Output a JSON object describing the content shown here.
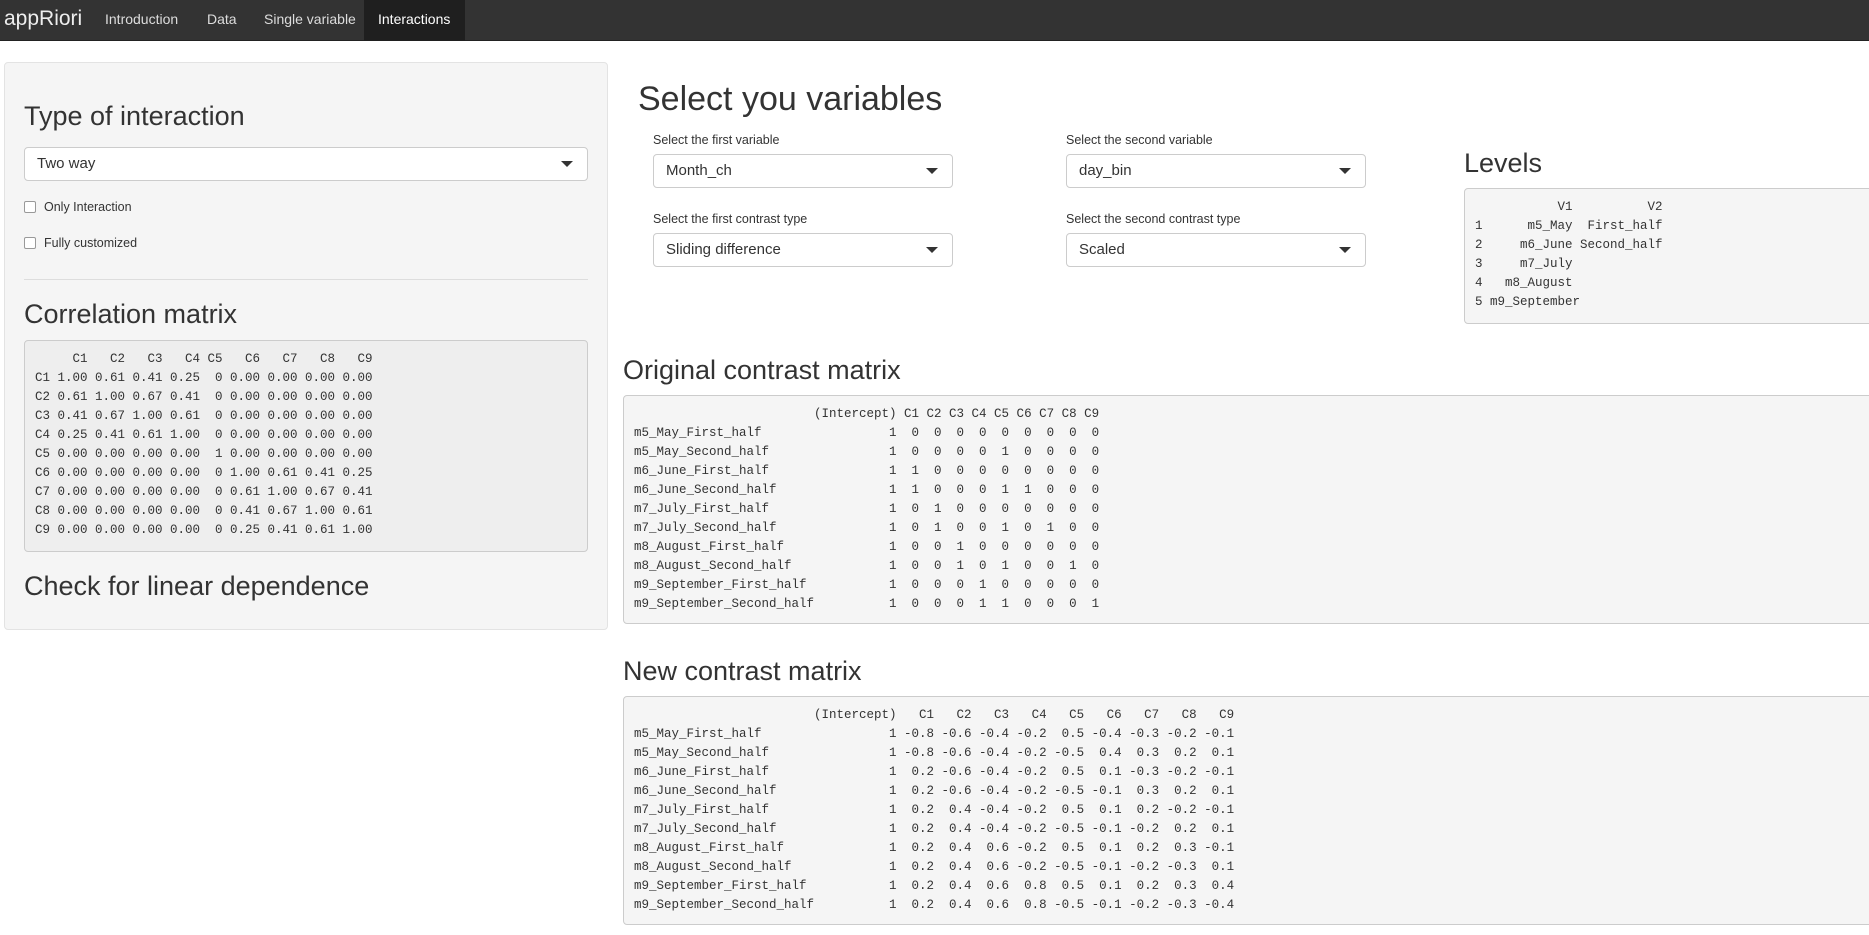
{
  "navbar": {
    "brand": "appRiori",
    "tabs": [
      "Introduction",
      "Data",
      "Single variable",
      "Interactions"
    ],
    "active_tab": "Interactions"
  },
  "sidebar": {
    "type_heading": "Type of interaction",
    "type_select_value": "Two way",
    "only_interaction_label": "Only Interaction",
    "fully_customized_label": "Fully customized",
    "correlation_heading": "Correlation matrix",
    "correlation_matrix": "     C1   C2   C3   C4 C5   C6   C7   C8   C9\nC1 1.00 0.61 0.41 0.25  0 0.00 0.00 0.00 0.00\nC2 0.61 1.00 0.67 0.41  0 0.00 0.00 0.00 0.00\nC3 0.41 0.67 1.00 0.61  0 0.00 0.00 0.00 0.00\nC4 0.25 0.41 0.61 1.00  0 0.00 0.00 0.00 0.00\nC5 0.00 0.00 0.00 0.00  1 0.00 0.00 0.00 0.00\nC6 0.00 0.00 0.00 0.00  0 1.00 0.61 0.41 0.25\nC7 0.00 0.00 0.00 0.00  0 0.61 1.00 0.67 0.41\nC8 0.00 0.00 0.00 0.00  0 0.41 0.67 1.00 0.61\nC9 0.00 0.00 0.00 0.00  0 0.25 0.41 0.61 1.00",
    "linear_dependence_heading": "Check for linear dependence"
  },
  "main": {
    "title": "Select you variables",
    "first_variable_label": "Select the first variable",
    "first_variable_value": "Month_ch",
    "second_variable_label": "Select the second variable",
    "second_variable_value": "day_bin",
    "first_contrast_label": "Select the first contrast type",
    "first_contrast_value": "Sliding difference",
    "second_contrast_label": "Select the second contrast type",
    "second_contrast_value": "Scaled",
    "levels_heading": "Levels",
    "levels_table": "           V1          V2\n1      m5_May  First_half\n2     m6_June Second_half\n3     m7_July\n4   m8_August\n5 m9_September",
    "original_heading": "Original contrast matrix",
    "original_matrix": "                        (Intercept) C1 C2 C3 C4 C5 C6 C7 C8 C9\nm5_May_First_half                 1  0  0  0  0  0  0  0  0  0\nm5_May_Second_half                1  0  0  0  0  1  0  0  0  0\nm6_June_First_half                1  1  0  0  0  0  0  0  0  0\nm6_June_Second_half               1  1  0  0  0  1  1  0  0  0\nm7_July_First_half                1  0  1  0  0  0  0  0  0  0\nm7_July_Second_half               1  0  1  0  0  1  0  1  0  0\nm8_August_First_half              1  0  0  1  0  0  0  0  0  0\nm8_August_Second_half             1  0  0  1  0  1  0  0  1  0\nm9_September_First_half           1  0  0  0  1  0  0  0  0  0\nm9_September_Second_half          1  0  0  0  1  1  0  0  0  1",
    "new_heading": "New contrast matrix",
    "new_matrix": "                        (Intercept)   C1   C2   C3   C4   C5   C6   C7   C8   C9\nm5_May_First_half                 1 -0.8 -0.6 -0.4 -0.2  0.5 -0.4 -0.3 -0.2 -0.1\nm5_May_Second_half                1 -0.8 -0.6 -0.4 -0.2 -0.5  0.4  0.3  0.2  0.1\nm6_June_First_half                1  0.2 -0.6 -0.4 -0.2  0.5  0.1 -0.3 -0.2 -0.1\nm6_June_Second_half               1  0.2 -0.6 -0.4 -0.2 -0.5 -0.1  0.3  0.2  0.1\nm7_July_First_half                1  0.2  0.4 -0.4 -0.2  0.5  0.1  0.2 -0.2 -0.1\nm7_July_Second_half               1  0.2  0.4 -0.4 -0.2 -0.5 -0.1 -0.2  0.2  0.1\nm8_August_First_half              1  0.2  0.4  0.6 -0.2  0.5  0.1  0.2  0.3 -0.1\nm8_August_Second_half             1  0.2  0.4  0.6 -0.2 -0.5 -0.1 -0.2 -0.3  0.1\nm9_September_First_half           1  0.2  0.4  0.6  0.8  0.5  0.1  0.2  0.3  0.4\nm9_September_Second_half          1  0.2  0.4  0.6  0.8 -0.5 -0.1 -0.2 -0.3 -0.4"
  }
}
